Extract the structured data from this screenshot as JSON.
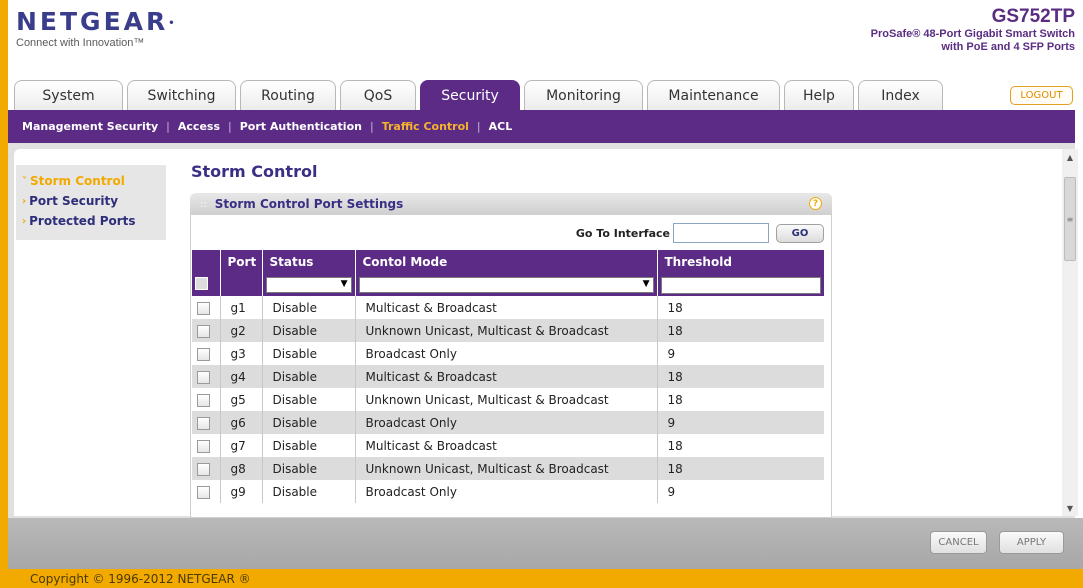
{
  "brand": {
    "name": "NETGEAR",
    "tagline": "Connect with Innovation™"
  },
  "model": {
    "name": "GS752TP",
    "line1": "ProSafe® 48-Port Gigabit Smart Switch",
    "line2": "with PoE and 4 SFP Ports"
  },
  "tabs": [
    {
      "label": "System",
      "active": false
    },
    {
      "label": "Switching",
      "active": false
    },
    {
      "label": "Routing",
      "active": false
    },
    {
      "label": "QoS",
      "active": false
    },
    {
      "label": "Security",
      "active": true
    },
    {
      "label": "Monitoring",
      "active": false
    },
    {
      "label": "Maintenance",
      "active": false
    },
    {
      "label": "Help",
      "active": false
    },
    {
      "label": "Index",
      "active": false
    }
  ],
  "logout_label": "LOGOUT",
  "subnav": [
    {
      "label": "Management Security",
      "active": false
    },
    {
      "label": "Access",
      "active": false
    },
    {
      "label": "Port Authentication",
      "active": false
    },
    {
      "label": "Traffic Control",
      "active": true
    },
    {
      "label": "ACL",
      "active": false
    }
  ],
  "sidemenu": [
    {
      "label": "Storm Control",
      "active": true
    },
    {
      "label": "Port Security",
      "active": false
    },
    {
      "label": "Protected Ports",
      "active": false
    }
  ],
  "page_title": "Storm Control",
  "panel": {
    "title": "Storm Control Port Settings",
    "goto_label": "Go To Interface",
    "goto_value": "",
    "go_button": "GO"
  },
  "table": {
    "columns": [
      "",
      "Port",
      "Status",
      "Contol Mode",
      "Threshold"
    ],
    "filter": {
      "status": "",
      "mode": "",
      "threshold": ""
    },
    "rows": [
      {
        "port": "g1",
        "status": "Disable",
        "mode": "Multicast & Broadcast",
        "threshold": "18"
      },
      {
        "port": "g2",
        "status": "Disable",
        "mode": "Unknown Unicast, Multicast & Broadcast",
        "threshold": "18"
      },
      {
        "port": "g3",
        "status": "Disable",
        "mode": "Broadcast Only",
        "threshold": "9"
      },
      {
        "port": "g4",
        "status": "Disable",
        "mode": "Multicast & Broadcast",
        "threshold": "18"
      },
      {
        "port": "g5",
        "status": "Disable",
        "mode": "Unknown Unicast, Multicast & Broadcast",
        "threshold": "18"
      },
      {
        "port": "g6",
        "status": "Disable",
        "mode": "Broadcast Only",
        "threshold": "9"
      },
      {
        "port": "g7",
        "status": "Disable",
        "mode": "Multicast & Broadcast",
        "threshold": "18"
      },
      {
        "port": "g8",
        "status": "Disable",
        "mode": "Unknown Unicast, Multicast & Broadcast",
        "threshold": "18"
      },
      {
        "port": "g9",
        "status": "Disable",
        "mode": "Broadcast Only",
        "threshold": "9"
      }
    ]
  },
  "buttons": {
    "cancel": "CANCEL",
    "apply": "APPLY"
  },
  "copyright": "Copyright © 1996-2012 NETGEAR ®",
  "colors": {
    "purple": "#5b2b86",
    "orange": "#f2a900",
    "title_blue": "#3a2f85"
  }
}
